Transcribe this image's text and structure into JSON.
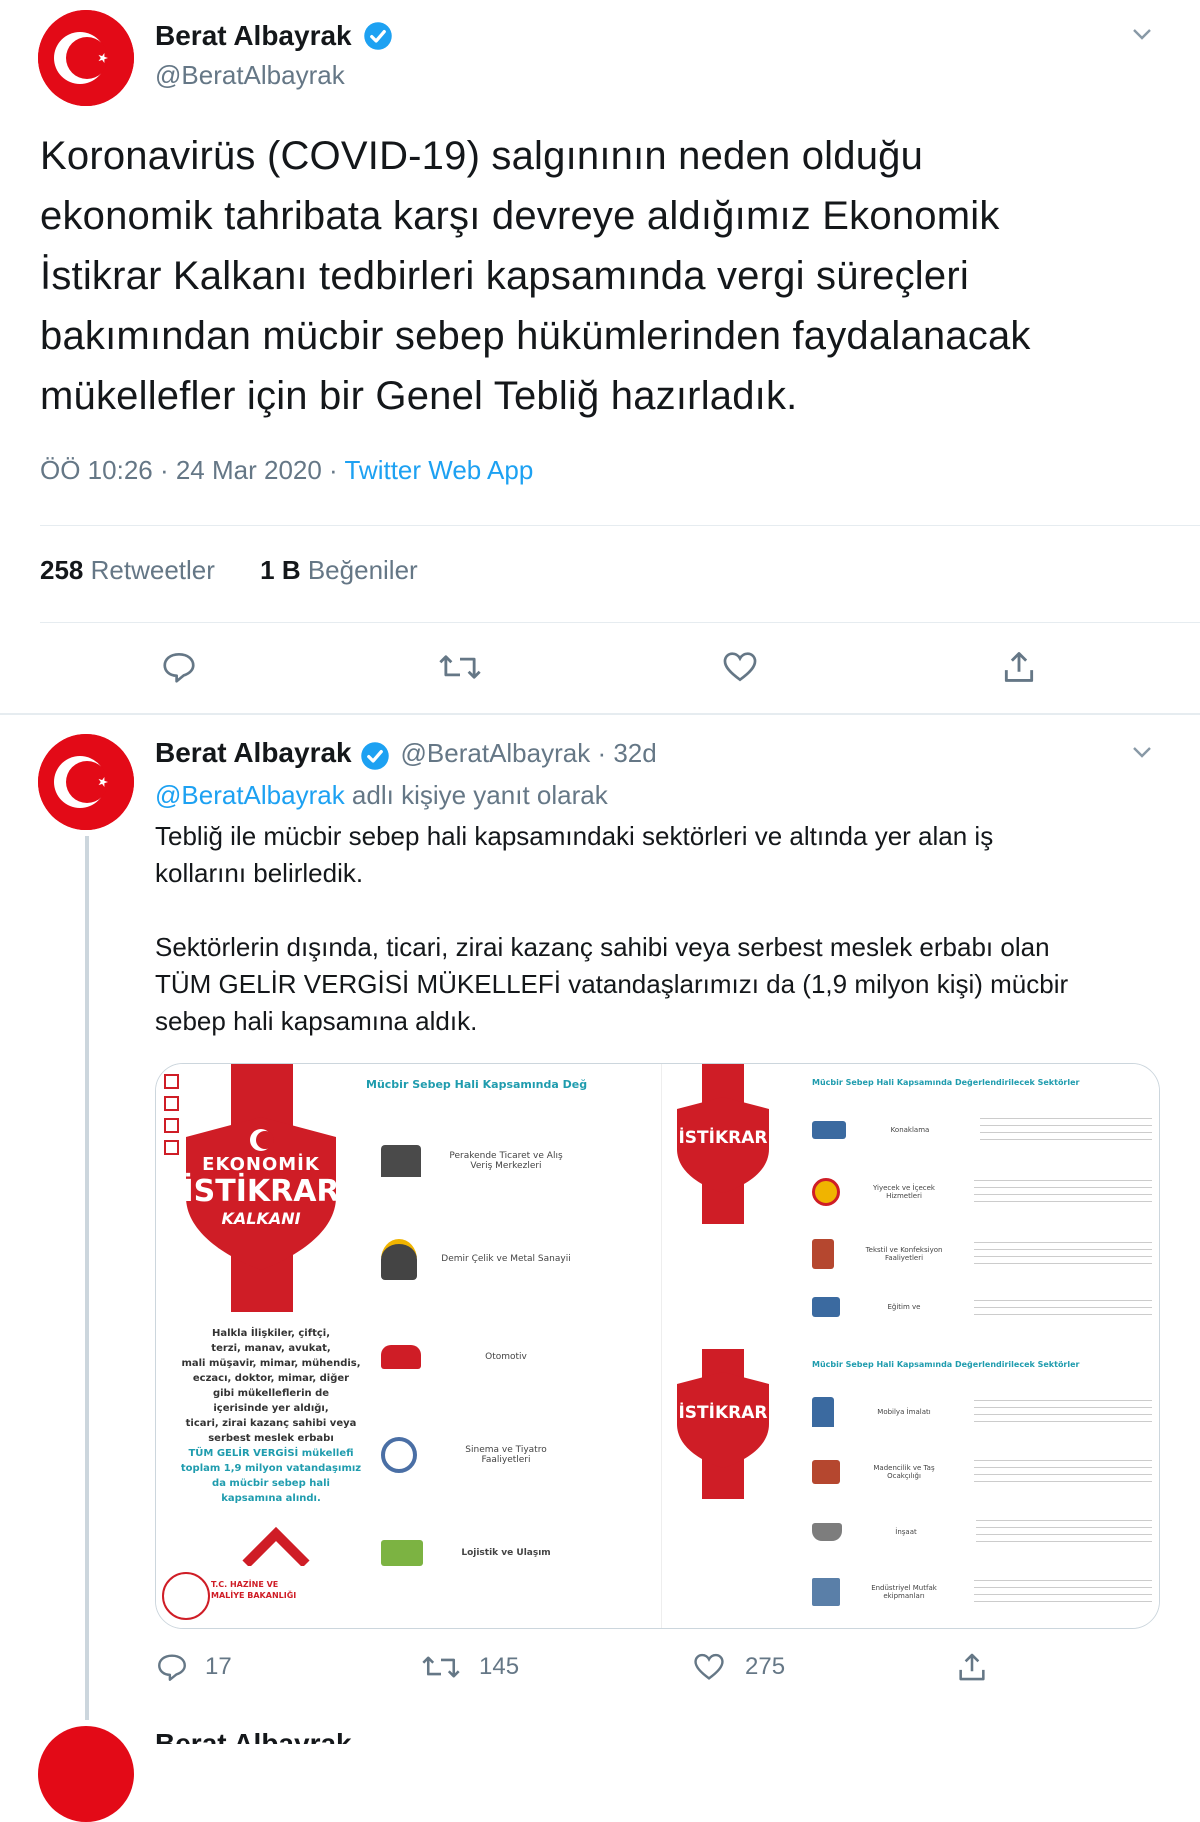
{
  "tweet": {
    "author_name": "Berat Albayrak",
    "author_handle": "@BeratAlbayrak",
    "text_lines": [
      "Koronavirüs (COVID-19) salgınının neden olduğu",
      "ekonomik tahribata karşı devreye aldığımız Ekonomik",
      "İstikrar Kalkanı tedbirleri kapsamında vergi süreçleri",
      "bakımından mücbir sebep hükümlerinden faydalanacak",
      "mükellefler için bir Genel Tebliğ hazırladık."
    ],
    "timestamp": "ÖÖ 10:26 · 24 Mar 2020 · ",
    "source": "Twitter Web App",
    "retweets_count": "258",
    "retweets_label": "Retweetler",
    "likes_count": "1 B",
    "likes_label": "Beğeniler"
  },
  "reply": {
    "author_name": "Berat Albayrak",
    "author_handle": "@BeratAlbayrak · 32d",
    "reply_to_handle": "@BeratAlbayrak",
    "reply_to_suffix": " adlı kişiye yanıt olarak",
    "text_lines_1": [
      "Tebliğ ile mücbir sebep hali kapsamındaki sektörleri ve altında yer alan iş",
      "kollarını belirledik."
    ],
    "text_lines_2": [
      "Sektörlerin dışında, ticari, zirai kazanç sahibi veya serbest meslek erbabı olan",
      "TÜM GELİR VERGİSİ MÜKELLEFİ vatandaşlarımızı da (1,9 milyon kişi) mücbir",
      "sebep hali kapsamına aldık."
    ],
    "reply_count": "17",
    "retweet_count": "145",
    "like_count": "275"
  },
  "media": {
    "left": {
      "banner_lines": [
        "EKONOMİK",
        "İSTİKRAR",
        "KALKANI"
      ],
      "header": "Mücbir Sebep Hali Kapsamında Değ",
      "items": [
        "Perakende Ticaret ve Alış Veriş Merkezleri",
        "Demir Çelik ve Metal Sanayii",
        "Otomotiv",
        "Sinema ve Tiyatro Faaliyetleri",
        "Lojistik ve Ulaşım"
      ],
      "body_lines": [
        "Halkla İlişkiler, çiftçi,",
        "terzi, manav, avukat,",
        "mali müşavir, mimar, mühendis,",
        "eczacı, doktor, mimar, diğer",
        "gibi mükelleflerin de",
        "içerisinde yer aldığı,",
        "ticari, zirai kazanç sahibi veya",
        "serbest meslek erbabı"
      ],
      "highlight_lines": [
        "TÜM GELİR VERGİSİ mükellefi",
        "toplam 1,9 milyon vatandaşımız",
        "da mücbir sebep hali",
        "kapsamına alındı."
      ],
      "ministry_lines": [
        "T.C. HAZİNE VE",
        "MALİYE BAKANLIĞI"
      ]
    },
    "right": {
      "header": "Mücbir Sebep Hali Kapsamında Değerlendirilecek Sektörler",
      "items_top": [
        "Konaklama",
        "Yiyecek ve İçecek Hizmetleri",
        "Tekstil ve Konfeksiyon Faaliyetleri",
        "Eğitim ve"
      ],
      "items_bottom": [
        "Mobilya İmalatı",
        "Madencilik ve Taş Ocakçılığı",
        "İnşaat",
        "Endüstriyel Mutfak ekipmanları"
      ]
    }
  },
  "colors": {
    "accent": "#1da1f2",
    "flag_red": "#e30a17",
    "banner_red": "#cf1d26",
    "teal": "#1f9cae"
  }
}
